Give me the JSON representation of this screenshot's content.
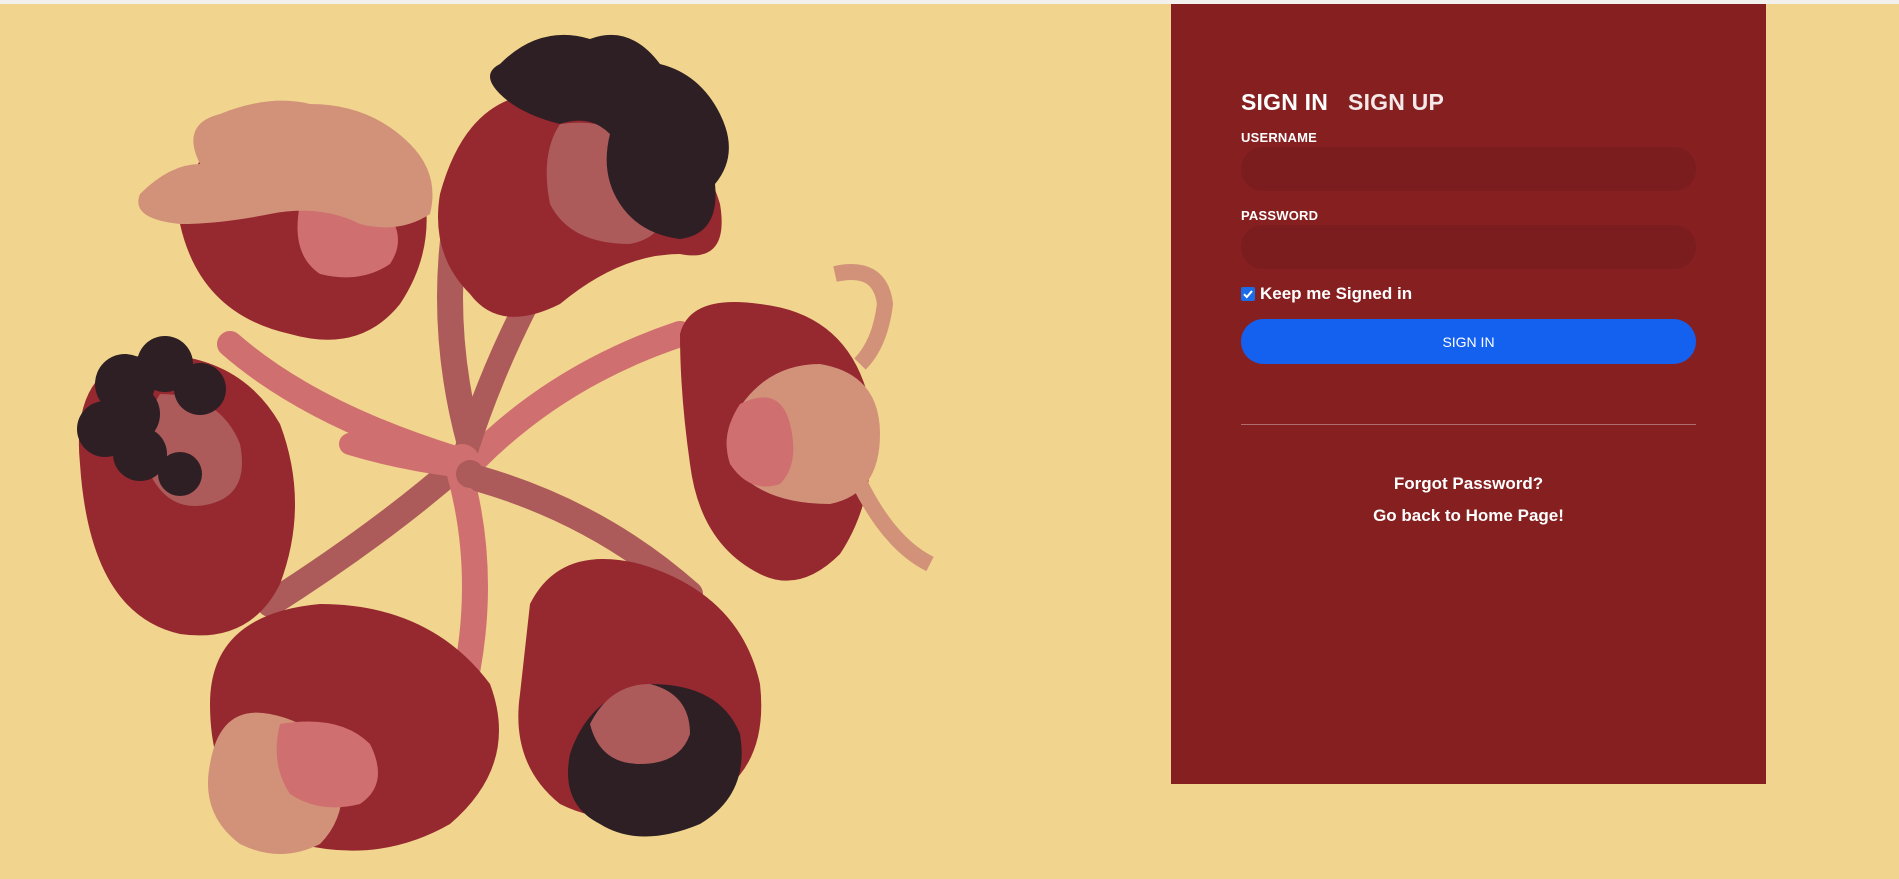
{
  "colors": {
    "page_background": "#f1d48d",
    "panel_background": "#861f20",
    "input_background": "#7b1c1e",
    "button_accent": "#1460ef",
    "checkbox_accent": "#1a6ce8"
  },
  "illustration": {
    "name": "people-circle-hands-together",
    "icon": "group-hands-illustration"
  },
  "auth": {
    "tabs": [
      {
        "label": "SIGN IN",
        "active": true
      },
      {
        "label": "SIGN UP",
        "active": false
      }
    ],
    "username": {
      "label": "USERNAME",
      "value": "",
      "placeholder": ""
    },
    "password": {
      "label": "PASSWORD",
      "value": "",
      "placeholder": ""
    },
    "keep_signed_in": {
      "label": "Keep me Signed in",
      "checked": true
    },
    "submit_label": "SIGN IN",
    "forgot_password": "Forgot Password?",
    "home_link": "Go back to Home Page!"
  }
}
